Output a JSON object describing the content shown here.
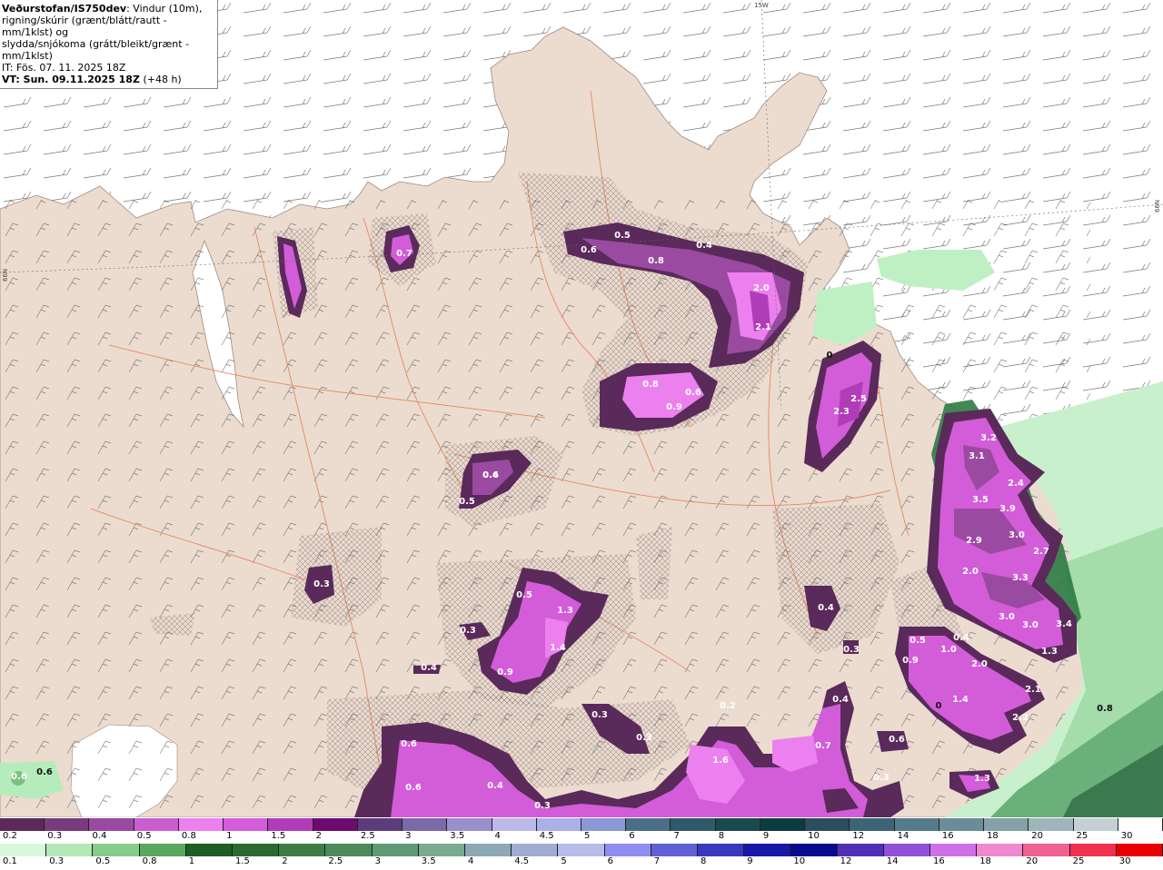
{
  "header": {
    "source": "Veðurstofan/IS750dev",
    "description_rest": ": Vindur (10m),",
    "line2": "rigning/skúrir (grænt/blátt/rautt - mm/1klst) og",
    "line3": "slydda/snjókoma (grátt/bleikt/grænt - mm/1klst)",
    "init_time": "IT: Fös. 07. 11. 2025 18Z",
    "valid_time": "VT: Sun. 09.11.2025 18Z",
    "lead": "(+48 h)"
  },
  "grid_labels": {
    "lon_15w": "15W",
    "lat_66n_left": "66N",
    "lat_66n_right": "66N"
  },
  "colors": {
    "land": "#ecdcd0",
    "sea": "#ffffff",
    "rivers": "#e8805a",
    "snow_purple_light": "#e070e8",
    "snow_purple_dark": "#5a2a5a",
    "rain_green_light": "#bff0c4",
    "rain_green_dark": "#2e6e48"
  },
  "precip_values": [
    {
      "v": "0.5"
    },
    {
      "v": "0.4"
    },
    {
      "v": "0.6"
    },
    {
      "v": "0.8"
    },
    {
      "v": "2.0"
    },
    {
      "v": "2.1"
    },
    {
      "v": "0.8"
    },
    {
      "v": "0.6"
    },
    {
      "v": "0.9"
    },
    {
      "v": "0.6"
    },
    {
      "v": "0.7"
    },
    {
      "v": "2.5"
    },
    {
      "v": "2.3"
    },
    {
      "v": "0"
    },
    {
      "v": "3.2"
    },
    {
      "v": "3.1"
    },
    {
      "v": "2.4"
    },
    {
      "v": "3.5"
    },
    {
      "v": "3.9"
    },
    {
      "v": "2.9"
    },
    {
      "v": "3.0"
    },
    {
      "v": "2.7"
    },
    {
      "v": "2.0"
    },
    {
      "v": "3.3"
    },
    {
      "v": "3.0"
    },
    {
      "v": "3.0"
    },
    {
      "v": "3.4"
    },
    {
      "v": "1.3"
    },
    {
      "v": "0.4"
    },
    {
      "v": "0.5"
    },
    {
      "v": "0.3"
    },
    {
      "v": "0.5"
    },
    {
      "v": "1.3"
    },
    {
      "v": "0.3"
    },
    {
      "v": "1.4"
    },
    {
      "v": "0.9"
    },
    {
      "v": "0.4"
    },
    {
      "v": "0.3"
    },
    {
      "v": "0.3"
    },
    {
      "v": "0.4"
    },
    {
      "v": "0.5"
    },
    {
      "v": "1.0"
    },
    {
      "v": "0.4"
    },
    {
      "v": "0.9"
    },
    {
      "v": "2.0"
    },
    {
      "v": "1.4"
    },
    {
      "v": "2.1"
    },
    {
      "v": "2.2"
    },
    {
      "v": "1.3"
    },
    {
      "v": "0"
    },
    {
      "v": "0.8"
    },
    {
      "v": "0.3"
    },
    {
      "v": "0.3"
    },
    {
      "v": "0.2"
    },
    {
      "v": "1.6"
    },
    {
      "v": "0.7"
    },
    {
      "v": "0.4"
    },
    {
      "v": "0.6"
    },
    {
      "v": "0.6"
    },
    {
      "v": "0.4"
    },
    {
      "v": "0.6"
    },
    {
      "v": "0.3"
    },
    {
      "v": "0.6"
    },
    {
      "v": "0.6"
    },
    {
      "v": "0.1"
    }
  ],
  "legend_snow": {
    "labels": [
      "0.2",
      "0.3",
      "0.4",
      "0.5",
      "0.8",
      "1",
      "1.5",
      "2",
      "2.5",
      "3",
      "3.5",
      "4",
      "4.5",
      "5",
      "6",
      "7",
      "8",
      "9",
      "10",
      "12",
      "14",
      "16",
      "18",
      "20",
      "25",
      "30"
    ],
    "colors": [
      "#5a2a5a",
      "#7a3a7e",
      "#9a4aa0",
      "#c95ed0",
      "#ec80ef",
      "#d35cd9",
      "#b03cb8",
      "#6c0c6e",
      "#5c3c7c",
      "#7a6aa8",
      "#9890cc",
      "#bcb8e8",
      "#aab0e8",
      "#8a98d6",
      "#4a6e8a",
      "#2e5a6a",
      "#1a4a50",
      "#0c3c40",
      "#2a4e5e",
      "#3c6474",
      "#537b88",
      "#6a8e98",
      "#84a0a8",
      "#a0b4bc",
      "#c4d0d6",
      "#ffffff"
    ]
  },
  "legend_rain": {
    "labels": [
      "0.1",
      "0.3",
      "0.5",
      "0.8",
      "1",
      "1.5",
      "2",
      "2.5",
      "3",
      "3.5",
      "4",
      "4.5",
      "5",
      "6",
      "7",
      "8",
      "9",
      "10",
      "12",
      "14",
      "16",
      "18",
      "20",
      "25",
      "30"
    ],
    "colors": [
      "#d8f8dc",
      "#b4e8b8",
      "#88cc8c",
      "#5aa860",
      "#1c5e24",
      "#2a6a30",
      "#3e7c46",
      "#4c8a5a",
      "#5e9a76",
      "#7aaa90",
      "#8ca8b4",
      "#a0acd0",
      "#b8bce8",
      "#8e8ef0",
      "#6060d8",
      "#3838c0",
      "#1818a8",
      "#0a0a90",
      "#5030b8",
      "#9050d8",
      "#d070e8",
      "#f088d0",
      "#f06090",
      "#f03050",
      "#e80000"
    ]
  }
}
